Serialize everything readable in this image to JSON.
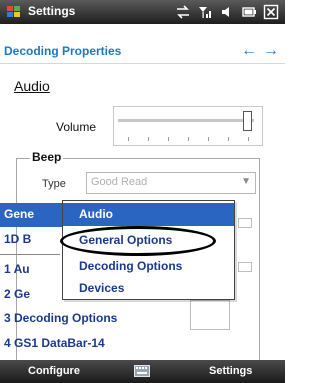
{
  "status_bar": {
    "title": "Settings",
    "start_icon": "windows-flag-icon",
    "icons": [
      "connectivity-icon",
      "signal-icon",
      "volume-icon",
      "battery-icon",
      "close-icon"
    ]
  },
  "page": {
    "title": "Decoding Properties",
    "nav_left": "←",
    "nav_right": "→"
  },
  "audio": {
    "heading": "Audio",
    "volume_label": "Volume",
    "volume_level": 0.95
  },
  "beep": {
    "legend": "Beep",
    "type_label": "Type",
    "type_value": "Good Read",
    "type_arrow": "▼"
  },
  "menu": {
    "rows": [
      "Gene",
      "1D B",
      "1 Au",
      "2 Ge",
      "3 Decoding Options",
      "4 GS1 DataBar-14"
    ],
    "popup_items": [
      "Audio",
      "General Options",
      "Decoding Options",
      "Devices"
    ],
    "selected_popup_item": "Audio",
    "circled_item": "General Options"
  },
  "bottom_bar": {
    "left_softkey": "Configure",
    "right_softkey": "Settings",
    "keyboard_icon": "keyboard-icon"
  },
  "colors": {
    "accent": "#1c78c4",
    "selection": "#2b65c2",
    "menu_text": "#1a3a8c"
  }
}
